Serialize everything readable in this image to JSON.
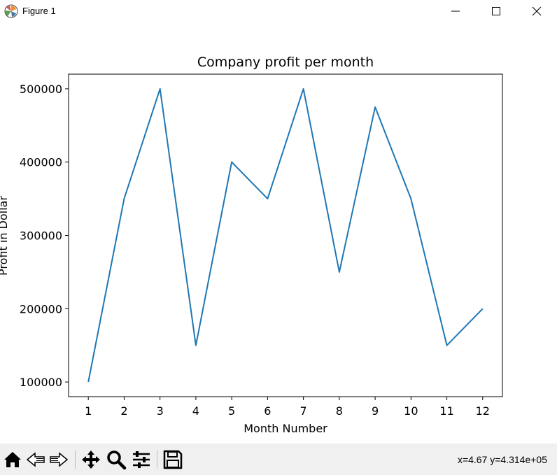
{
  "window": {
    "title": "Figure 1"
  },
  "toolbar": {
    "buttons": [
      {
        "name": "home-icon"
      },
      {
        "name": "back-arrow-icon"
      },
      {
        "name": "forward-arrow-icon"
      },
      {
        "name": "pan-icon"
      },
      {
        "name": "zoom-icon"
      },
      {
        "name": "configure-subplots-icon"
      },
      {
        "name": "save-icon"
      }
    ],
    "coords": "x=4.67 y=4.314e+05"
  },
  "colors": {
    "line": "#1f77b4",
    "toolbar_bg": "#f0f0f0"
  },
  "chart_data": {
    "type": "line",
    "title": "Company profit per month",
    "xlabel": "Month Number",
    "ylabel": "Profit in Dollar",
    "x": [
      1,
      2,
      3,
      4,
      5,
      6,
      7,
      8,
      9,
      10,
      11,
      12
    ],
    "series": [
      {
        "values": [
          100000,
          350000,
          500000,
          150000,
          400000,
          350000,
          500000,
          250000,
          475000,
          350000,
          150000,
          200000
        ]
      }
    ],
    "xticks": [
      1,
      2,
      3,
      4,
      5,
      6,
      7,
      8,
      9,
      10,
      11,
      12
    ],
    "yticks": [
      100000,
      200000,
      300000,
      400000,
      500000
    ],
    "xlim": [
      0.45,
      12.55
    ],
    "ylim": [
      80000,
      520000
    ],
    "grid": false,
    "legend": false
  }
}
